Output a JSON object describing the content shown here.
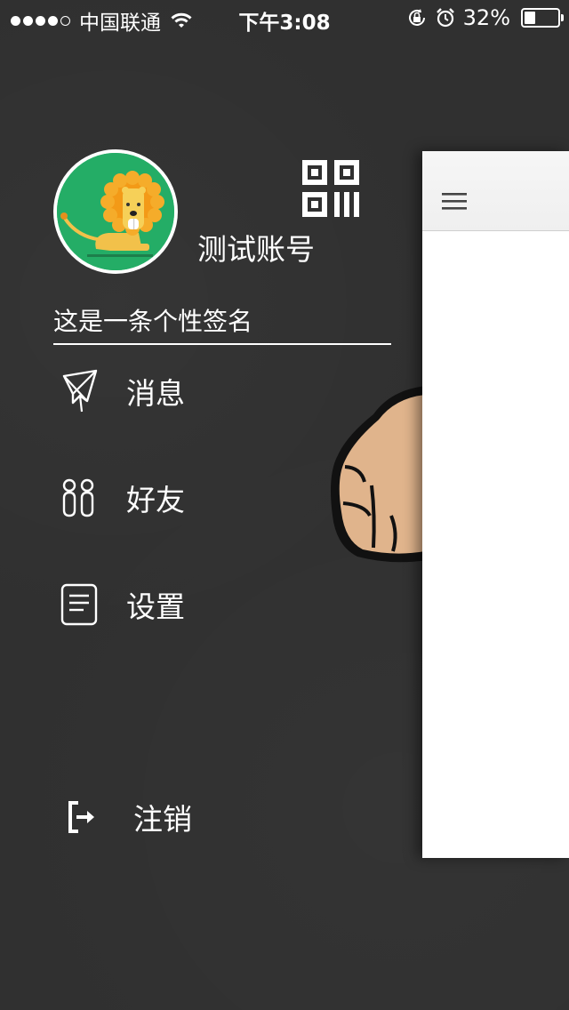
{
  "status_bar": {
    "carrier": "中国联通",
    "time": "下午3:08",
    "battery_percent": "32%",
    "battery_level": 0.32
  },
  "profile": {
    "account_name": "测试账号",
    "signature": "这是一条个性签名"
  },
  "menu": {
    "items": [
      {
        "label": "消息",
        "icon": "paper-plane-icon"
      },
      {
        "label": "好友",
        "icon": "footprints-icon"
      },
      {
        "label": "设置",
        "icon": "document-icon"
      }
    ],
    "logout": {
      "label": "注销",
      "icon": "logout-icon"
    }
  },
  "colors": {
    "background": "#303030",
    "avatar_bg": "#24ad66",
    "panel": "#ffffff"
  }
}
